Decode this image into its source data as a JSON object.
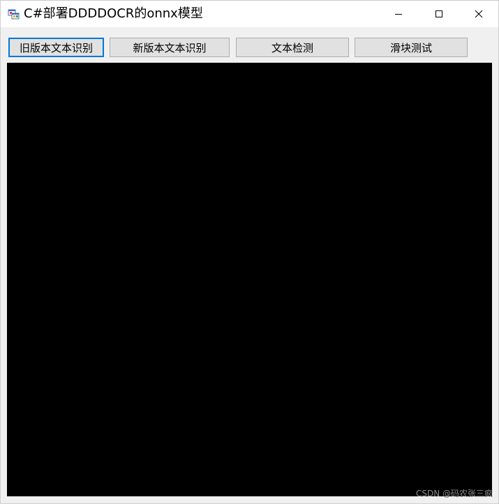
{
  "window": {
    "title": "C#部署DDDDOCR的onnx模型",
    "app_icon": "winforms-app-icon",
    "controls": {
      "minimize_icon": "minimize-icon",
      "maximize_icon": "maximize-icon",
      "close_icon": "close-icon"
    }
  },
  "toolbar": {
    "old_ocr_label": "旧版本文本识别",
    "new_ocr_label": "新版本文本识别",
    "text_detect_label": "文本检测",
    "slider_test_label": "滑块测试"
  },
  "picture": {
    "background": "#000000"
  },
  "watermark": {
    "text": "CSDN @码农张三疯"
  },
  "colors": {
    "focus_border": "#0078d7",
    "button_face": "#e1e1e1",
    "window_bg": "#f0f0f0"
  }
}
